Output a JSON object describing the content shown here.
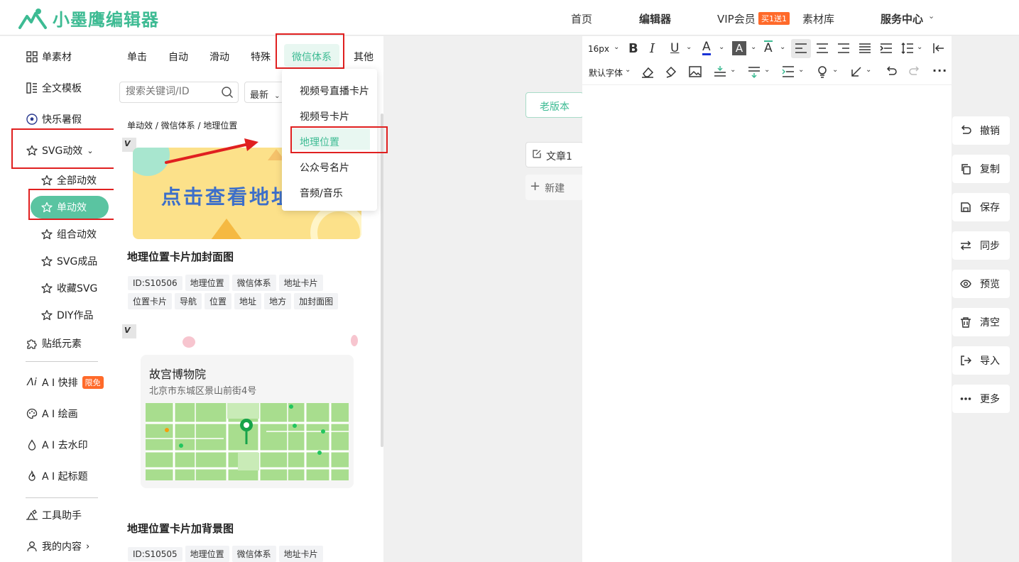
{
  "header": {
    "logo_text": "小墨鹰编辑器",
    "nav": {
      "home": "首页",
      "editor": "编辑器",
      "vip": "VIP会员",
      "vip_badge": "买1送1",
      "library": "素材库",
      "service": "服务中心"
    }
  },
  "sidebar": {
    "items": {
      "single": "单素材",
      "template": "全文模板",
      "summer": "快乐暑假",
      "svg": "SVG动效",
      "sticker": "贴纸元素",
      "ai_layout": "A I 快排",
      "ai_layout_badge": "限免",
      "ai_draw": "A I 绘画",
      "ai_watermark": "A I 去水印",
      "ai_title": "A I 起标题",
      "tools": "工具助手",
      "mine": "我的内容"
    },
    "svg_sub": {
      "all": "全部动效",
      "single": "单动效",
      "combo": "组合动效",
      "finished": "SVG成品",
      "fav": "收藏SVG",
      "diy": "DIY作品"
    }
  },
  "middle": {
    "tabs": [
      "单击",
      "自动",
      "滑动",
      "特殊",
      "微信体系",
      "其他"
    ],
    "search_placeholder": "搜索关键词/ID",
    "sort": "最新",
    "breadcrumb": "单动效 / 微信体系 / 地理位置",
    "card1": {
      "banner_text": "点击查看地址",
      "title": "地理位置卡片加封面图",
      "tags_row1": [
        "ID:S10506",
        "地理位置",
        "微信体系",
        "地址卡片"
      ],
      "tags_row2": [
        "位置卡片",
        "导航",
        "位置",
        "地址",
        "地方",
        "加封面图"
      ]
    },
    "card2": {
      "place_name": "故宫博物院",
      "place_addr": "北京市东城区景山前街4号",
      "title": "地理位置卡片加背景图",
      "tags_row1": [
        "ID:S10505",
        "地理位置",
        "微信体系",
        "地址卡片"
      ]
    }
  },
  "dropdown": {
    "items": [
      "视频号直播卡片",
      "视频号卡片",
      "地理位置",
      "公众号名片",
      "音频/音乐"
    ]
  },
  "articles": {
    "old_version": "老版本",
    "article1": "文章1",
    "new": "新建"
  },
  "toolbar": {
    "font_size": "16px",
    "font_family": "默认字体"
  },
  "right_actions": [
    "撤销",
    "复制",
    "保存",
    "同步",
    "预览",
    "清空",
    "导入",
    "更多"
  ],
  "colors": {
    "accent": "#3dbb93",
    "highlight_box": "#e02020",
    "arrow": "#e02020"
  }
}
